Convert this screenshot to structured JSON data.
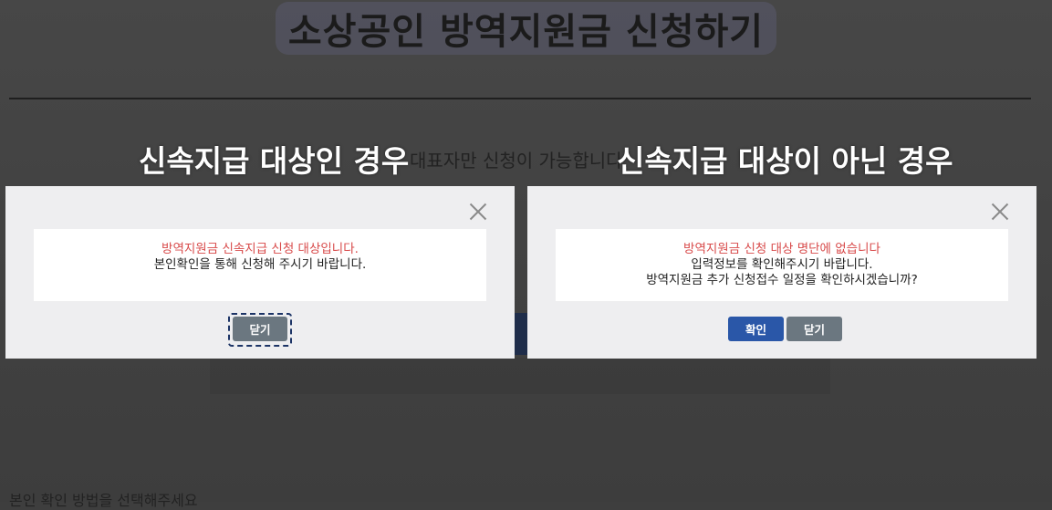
{
  "page": {
    "title": "소상공인 방역지원금 신청하기",
    "notice": "대표자만 신청이 가능합니다.",
    "method_prompt": "본인 확인 방법을 선택해주세요"
  },
  "captions": {
    "left": "신속지급 대상인 경우",
    "right": "신속지급 대상이 아닌 경우"
  },
  "dialog_eligible": {
    "message_highlight": "방역지원금 신속지급 신청 대상입니다.",
    "message_body": "본인확인을 통해 신청해 주시기 바랍니다.",
    "close_label": "닫기",
    "close_icon": "close-icon"
  },
  "dialog_not_eligible": {
    "message_highlight": "방역지원금 신청 대상 명단에 없습니다",
    "message_line2": "입력정보를 확인해주시기 바랍니다.",
    "message_line3": "방역지원금 추가 신청접수 일정을 확인하시겠습니까?",
    "confirm_label": "확인",
    "close_label": "닫기",
    "close_icon": "close-icon"
  },
  "colors": {
    "highlight_red": "#d84a4a",
    "confirm_blue": "#2a57a8",
    "close_gray": "#6b7780",
    "overlay": "#3e3e3e"
  }
}
